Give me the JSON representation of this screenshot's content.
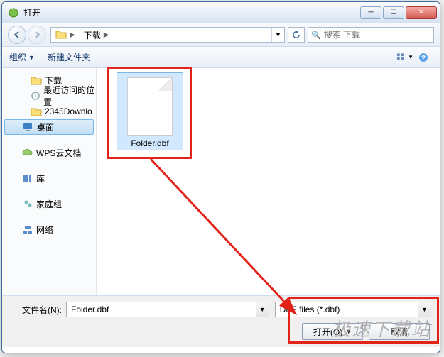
{
  "window": {
    "title": "打开"
  },
  "nav": {
    "breadcrumb": [
      {
        "label": "下载"
      }
    ],
    "search_placeholder": "搜索 下载"
  },
  "toolbar": {
    "organize": "组织",
    "new_folder": "新建文件夹"
  },
  "sidebar": {
    "downloads": "下载",
    "recent": "最近访问的位置",
    "folder2345": "2345Downlo",
    "desktop": "桌面",
    "wps": "WPS云文档",
    "libraries": "库",
    "homegroup": "家庭组",
    "network": "网络"
  },
  "files": [
    {
      "name": "Folder.dbf"
    }
  ],
  "bottom": {
    "filename_label": "文件名(N):",
    "filename_value": "Folder.dbf",
    "filter_value": "DBF files (*.dbf)",
    "open": "打开(O)",
    "cancel": "取消"
  },
  "watermark": "极速下载站"
}
